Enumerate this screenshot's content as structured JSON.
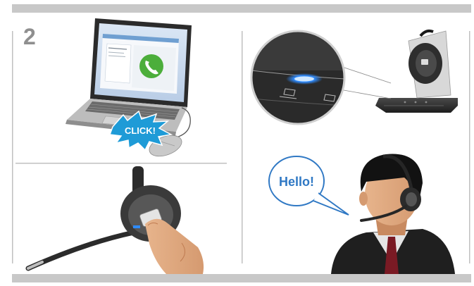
{
  "step": {
    "number": "2"
  },
  "panels": {
    "laptop": {
      "callout": "CLICK!"
    },
    "speech": {
      "bubble": "Hello!"
    }
  },
  "colors": {
    "frame_gray": "#c8c8c8",
    "divider_gray": "#b8b8b8",
    "led_blue": "#2e8bff",
    "burst_blue": "#1e9bd7",
    "speech_text_blue": "#2f78c4",
    "phone_green": "#4cae3b"
  }
}
